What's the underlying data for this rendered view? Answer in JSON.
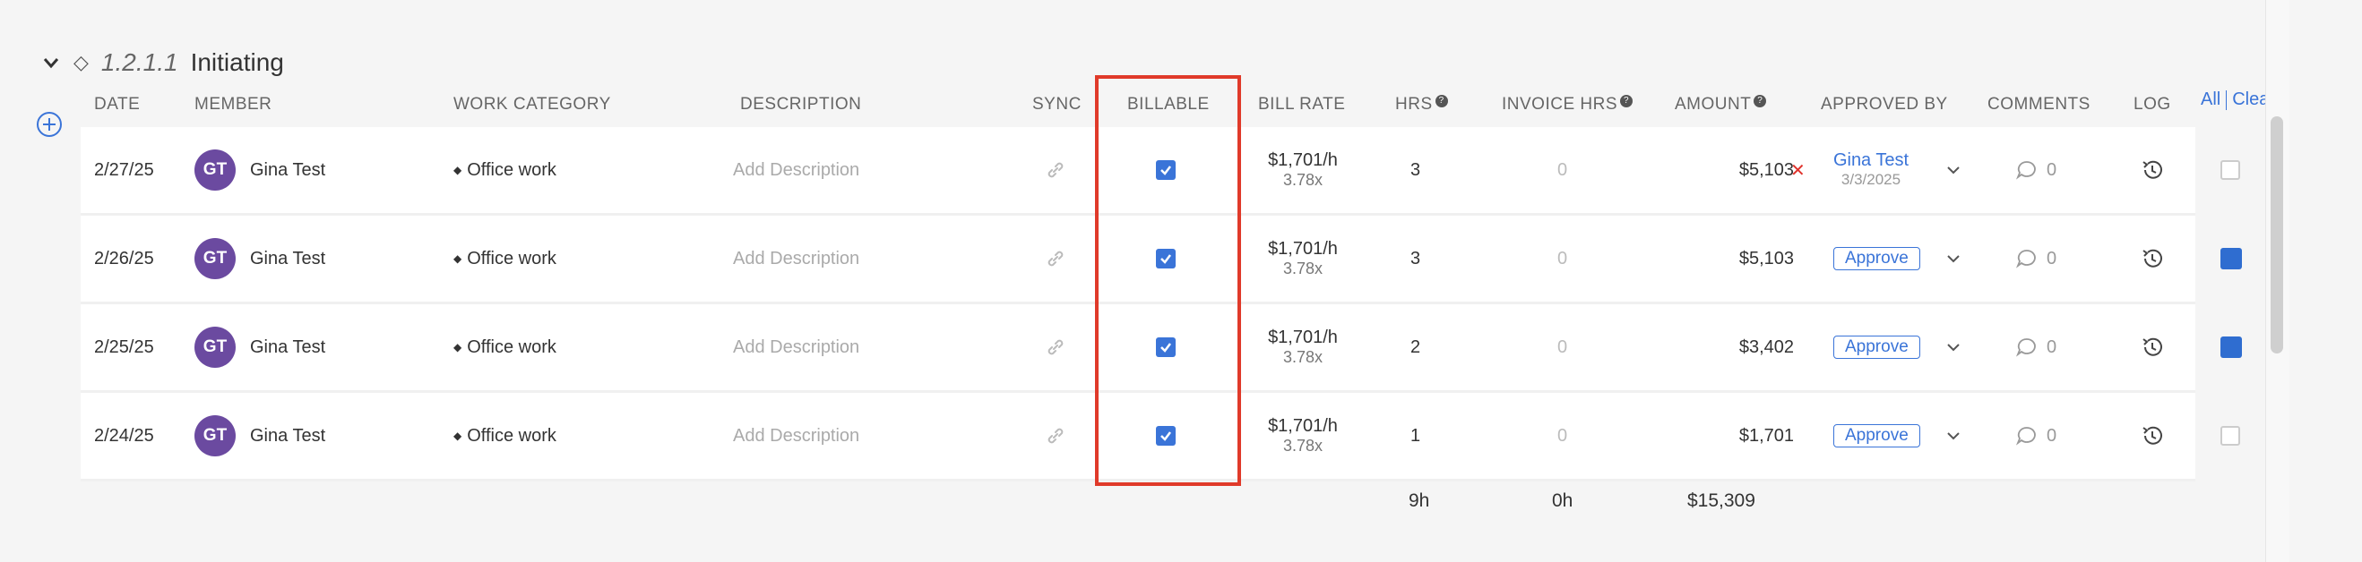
{
  "section": {
    "phase_number": "1.2.1.1",
    "phase_name": "Initiating"
  },
  "columns": {
    "date": "DATE",
    "member": "MEMBER",
    "work_category": "WORK CATEGORY",
    "description": "DESCRIPTION",
    "sync": "SYNC",
    "billable": "BILLABLE",
    "bill_rate": "BILL RATE",
    "hrs": "HRS",
    "invoice_hrs": "INVOICE HRS",
    "amount": "AMOUNT",
    "approved_by": "APPROVED BY",
    "comments": "COMMENTS",
    "log": "LOG"
  },
  "select": {
    "all": "All",
    "clear": "Clea"
  },
  "rows": [
    {
      "date": "2/27/25",
      "initials": "GT",
      "member": "Gina Test",
      "category": "Office work",
      "description_placeholder": "Add Description",
      "rate": "$1,701/h",
      "multiplier": "3.78x",
      "hrs": "3",
      "invoice_hrs": "0",
      "amount": "$5,103",
      "approved_by": "Gina Test",
      "approved_date": "3/3/2025",
      "approve_label": "",
      "comments": "0",
      "selected": false,
      "billable": true
    },
    {
      "date": "2/26/25",
      "initials": "GT",
      "member": "Gina Test",
      "category": "Office work",
      "description_placeholder": "Add Description",
      "rate": "$1,701/h",
      "multiplier": "3.78x",
      "hrs": "3",
      "invoice_hrs": "0",
      "amount": "$5,103",
      "approved_by": "",
      "approved_date": "",
      "approve_label": "Approve",
      "comments": "0",
      "selected": true,
      "billable": true
    },
    {
      "date": "2/25/25",
      "initials": "GT",
      "member": "Gina Test",
      "category": "Office work",
      "description_placeholder": "Add Description",
      "rate": "$1,701/h",
      "multiplier": "3.78x",
      "hrs": "2",
      "invoice_hrs": "0",
      "amount": "$3,402",
      "approved_by": "",
      "approved_date": "",
      "approve_label": "Approve",
      "comments": "0",
      "selected": true,
      "billable": true
    },
    {
      "date": "2/24/25",
      "initials": "GT",
      "member": "Gina Test",
      "category": "Office work",
      "description_placeholder": "Add Description",
      "rate": "$1,701/h",
      "multiplier": "3.78x",
      "hrs": "1",
      "invoice_hrs": "0",
      "amount": "$1,701",
      "approved_by": "",
      "approved_date": "",
      "approve_label": "Approve",
      "comments": "0",
      "selected": false,
      "billable": true
    }
  ],
  "totals": {
    "hrs": "9h",
    "invoice_hrs": "0h",
    "amount": "$15,309"
  },
  "colors": {
    "accent": "#3a74d8",
    "avatar": "#6b4aa0",
    "highlight": "#e03a2a",
    "reject": "#e0322b"
  }
}
